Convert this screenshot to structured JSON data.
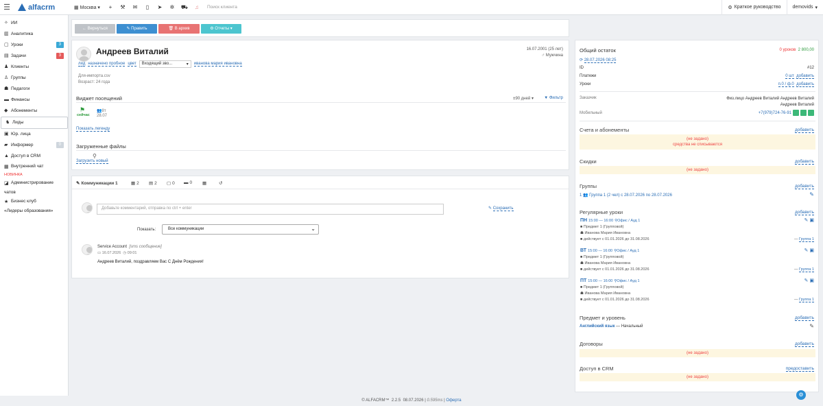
{
  "topbar": {
    "logo": "alfacrm",
    "branch": "Москва",
    "search_placeholder": "Поиск клиента",
    "guide": "Краткое руководство",
    "user": "demovids"
  },
  "sidebar": {
    "items": [
      {
        "label": "ИИ",
        "icon": "ai-icon"
      },
      {
        "label": "Аналитика",
        "icon": "analytics-icon"
      },
      {
        "label": "Уроки",
        "icon": "lessons-icon",
        "badge": "3",
        "badge_color": "#3aa9d6"
      },
      {
        "label": "Задачи",
        "icon": "tasks-icon",
        "badge": "3",
        "badge_color": "#e55a5a"
      },
      {
        "label": "Клиенты",
        "icon": "user-icon"
      },
      {
        "label": "Группы",
        "icon": "users-icon"
      },
      {
        "label": "Педагоги",
        "icon": "teacher-icon"
      },
      {
        "label": "Финансы",
        "icon": "money-icon"
      },
      {
        "label": "Абонементы",
        "icon": "tag-icon"
      },
      {
        "label": "Лиды",
        "icon": "lead-icon"
      },
      {
        "label": "Юр. лица",
        "icon": "company-icon"
      },
      {
        "label": "Информер",
        "icon": "informer-icon",
        "badge": "0",
        "badge_color": "#cfd6dd"
      },
      {
        "label": "Доступ в CRM",
        "icon": "lock-icon"
      },
      {
        "label": "Внутренний чат",
        "icon": "chat-icon",
        "sub": "НОВИНКА"
      },
      {
        "label": "Администрирование",
        "label2": "чатов",
        "icon": "admin-icon"
      },
      {
        "label": "Бизнес клуб",
        "label2": "«Лидеры образования»",
        "icon": "star-icon"
      }
    ]
  },
  "actions": {
    "back": "← Вернуться",
    "edit": "✎ Править",
    "archive": "🗑 В архив",
    "reports": "⚙ Отчеты ▾",
    "colors": {
      "back": "#bfc3c8",
      "edit": "#3d8fd1",
      "archive": "#e87373",
      "reports": "#4cc5cf"
    }
  },
  "profile": {
    "name": "Андреев Виталий",
    "birth": "16.07.2001 (25 лет)",
    "gender": "Мужчина",
    "status_lead": "лид",
    "status_trial": "назначено пробное",
    "color_label": "цвет",
    "source_select": "Входящий зво...",
    "manager": "иванова мария ивановна",
    "file_note": "Для-импорта.csv",
    "age": "Возраст: 24 года",
    "widget_title": "Виджет посещений",
    "period": "±90 дней",
    "filter": "Фильтр",
    "now_label": "сейчас",
    "visit_count": "8т",
    "visit_date": "28.07",
    "legend_link": "Показать легенду",
    "files_title": "Загруженные файлы",
    "upload_link": "Загрузить новый"
  },
  "comms": {
    "tabs": [
      {
        "label": "Коммуникации 1",
        "icon": "comm-icon"
      },
      {
        "label": "2",
        "icon": "chat-icon"
      },
      {
        "label": "2",
        "icon": "doc-icon"
      },
      {
        "label": "0",
        "icon": "lessons-icon"
      },
      {
        "label": "0",
        "icon": "money-icon"
      },
      {
        "label": "",
        "icon": "grid-icon"
      },
      {
        "label": "",
        "icon": "history-icon"
      }
    ],
    "comment_placeholder": "Добавьте комментарий, отправка по ctrl + enter",
    "save": "Сохранить",
    "show_label": "Показать:",
    "show_value": "Все коммуникации",
    "msg_author": "Service Account",
    "msg_type": "[sms сообщение]",
    "msg_date": "16.07.2026",
    "msg_time": "09:01",
    "msg_text": "Андреев Виталий, поздравляем Вас С Днём Рождения!"
  },
  "right": {
    "balance_title": "Общий остаток",
    "balance_lessons": "0 уроков",
    "balance_money": "2 800,00",
    "balance_date": "28.07.2026 08:25",
    "id_label": "ID",
    "id_value": "#12",
    "payments_label": "Платежи",
    "payments_value": "0 шт",
    "payments_add": "добавить",
    "lessons_label": "Уроки",
    "lessons_value": "п.0 / ф.0",
    "lessons_add": "добавить",
    "customer_label": "Заказчик",
    "customer_value": "Физ.лицо Андреев Виталий Андреев Виталий Андреев Виталий",
    "mobile_label": "Мобильный",
    "mobile_value": "+7(979)724-76-91",
    "accounts_title": "Счета и абонементы",
    "accounts_add": "добавить",
    "not_set": "(не задано)",
    "not_charged": "средства не списываются",
    "discounts_title": "Скидки",
    "groups_title": "Группы",
    "group_line": "Группа 1 (2 чел) с 28.07.2026 по 28.07.2026",
    "group_num": "1",
    "regular_title": "Регулярные уроки",
    "lessons": [
      {
        "day": "ПН",
        "time": "15:00 — 16:00",
        "place": "Офис / Ауд 1",
        "subject": "Предмет 1 (Групповой)",
        "teacher": "Иванова Мария Ивановна",
        "period": "действует с 01.01.2026 до 31.08.2026",
        "group": "Группа 1"
      },
      {
        "day": "ВТ",
        "time": "15:00 — 16:00",
        "place": "Офис / Ауд 1",
        "subject": "Предмет 1 (Групповой)",
        "teacher": "Иванова Мария Ивановна",
        "period": "действует с 01.01.2026 до 31.08.2026",
        "group": "Группа 1"
      },
      {
        "day": "ПТ",
        "time": "15:00 — 16:00",
        "place": "Офис / Ауд 1",
        "subject": "Предмет 1 (Групповой)",
        "teacher": "Иванова Мария Ивановна",
        "period": "действует с 01.01.2026 до 31.08.2026",
        "group": "Группа 1"
      }
    ],
    "subject_title": "Предмет и уровень",
    "subject_value": "Английский язык",
    "subject_level": "— Начальный",
    "contracts_title": "Договоры",
    "access_title": "Доступ в CRM",
    "access_action": "предоставить",
    "add": "добавить"
  },
  "footer": {
    "brand": "© ALFACRM™",
    "version": "2.2.5",
    "date": "08.07.2026",
    "time": "0.595ms",
    "offer": "Оферта"
  }
}
